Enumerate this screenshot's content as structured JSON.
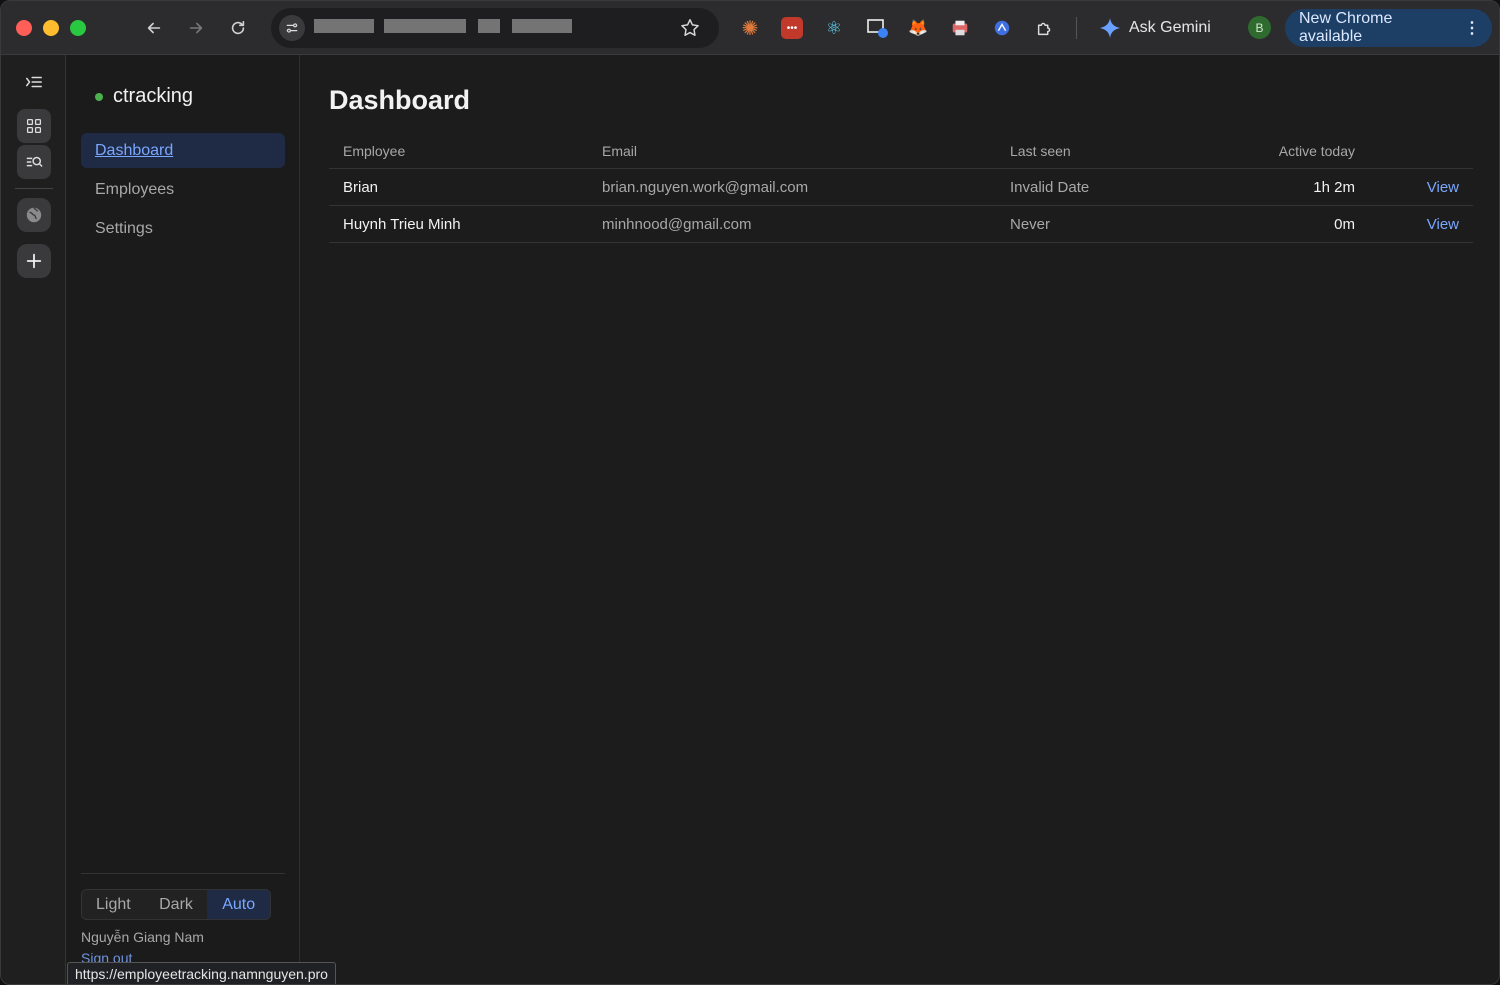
{
  "browser": {
    "gemini_label": "Ask Gemini",
    "profile_initial": "B",
    "update_label": "New Chrome available",
    "update_menu": "⋮",
    "status_url": "https://employeetracking.namnguyen.pro"
  },
  "sidebar": {
    "brand": "ctracking",
    "items": [
      {
        "label": "Dashboard"
      },
      {
        "label": "Employees"
      },
      {
        "label": "Settings"
      }
    ],
    "theme": {
      "light": "Light",
      "dark": "Dark",
      "auto": "Auto",
      "selected": "Auto"
    },
    "user_name": "Nguyễn Giang Nam",
    "sign_out": "Sign out"
  },
  "main": {
    "title": "Dashboard",
    "columns": {
      "employee": "Employee",
      "email": "Email",
      "last_seen": "Last seen",
      "active_today": "Active today"
    },
    "rows": [
      {
        "employee": "Brian",
        "email": "brian.nguyen.work@gmail.com",
        "last_seen": "Invalid Date",
        "active_today": "1h 2m",
        "action": "View"
      },
      {
        "employee": "Huynh Trieu Minh",
        "email": "minhnood@gmail.com",
        "last_seen": "Never",
        "active_today": "0m",
        "action": "View"
      }
    ]
  },
  "colors": {
    "accent": "#7aa7ff",
    "active_bg": "#1f2a44",
    "status_dot": "#4caf50"
  },
  "icons": [
    "back-icon",
    "forward-icon",
    "reload-icon",
    "site-info-icon",
    "bookmark-star-icon",
    "extensions-icon",
    "gemini-icon",
    "sidebar-toggle-icon",
    "grid-icon",
    "search-list-icon",
    "globe-icon",
    "plus-icon"
  ]
}
